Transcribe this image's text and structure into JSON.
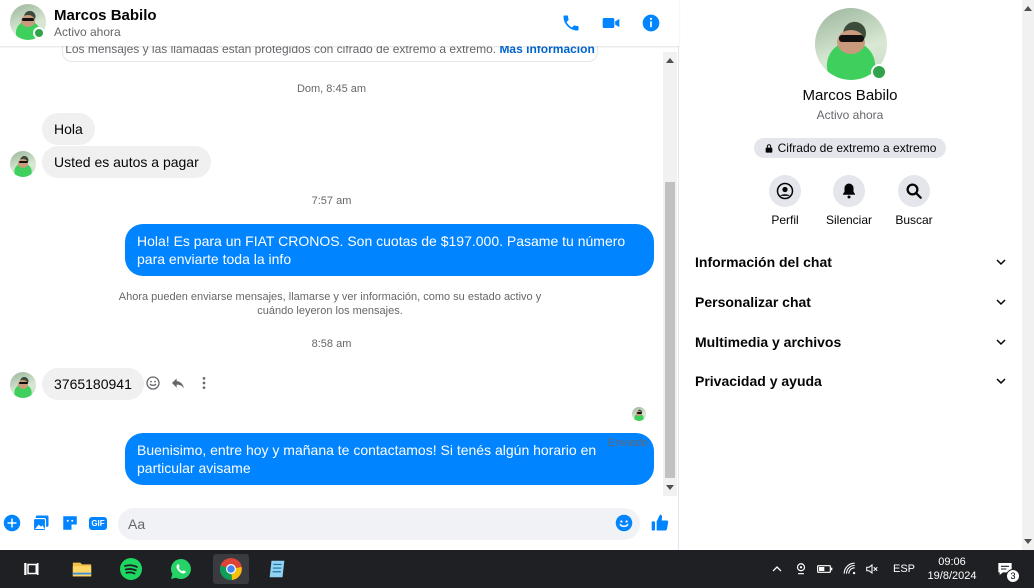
{
  "contact": {
    "name": "Marcos Babilo",
    "status": "Activo ahora"
  },
  "banner": {
    "text": "Los mensajes y las llamadas están protegidos con cifrado de extremo a extremo.",
    "link": "Más información"
  },
  "conversation": {
    "ts1": "Dom, 8:45 am",
    "msg1": "Hola",
    "msg2": "Usted es autos a pagar",
    "ts2": "7:57 am",
    "msg3": "Hola! Es para un FIAT CRONOS. Son cuotas de $197.000. Pasame tu número para enviarte toda la info",
    "notice": "Ahora pueden enviarse mensajes, llamarse y ver información, como su estado activo y cuándo leyeron los mensajes.",
    "ts3": "8:58 am",
    "msg4": "3765180941",
    "msg5": "Buenisimo, entre hoy y mañana te contactamos! Si tenés algún horario en particular avisame",
    "sent_label": "Enviado"
  },
  "composer": {
    "placeholder": "Aa"
  },
  "info_panel": {
    "e2e_label": "Cifrado de extremo a extremo",
    "actions": [
      {
        "label": "Perfil",
        "icon": "profile-icon"
      },
      {
        "label": "Silenciar",
        "icon": "bell-icon"
      },
      {
        "label": "Buscar",
        "icon": "search-icon"
      }
    ],
    "sections": [
      {
        "label": "Información del chat"
      },
      {
        "label": "Personalizar chat"
      },
      {
        "label": "Multimedia y archivos"
      },
      {
        "label": "Privacidad y ayuda"
      }
    ]
  },
  "taskbar": {
    "language": "ESP",
    "time": "09:06",
    "date": "19/8/2024",
    "notifications": "3"
  },
  "colors": {
    "accent": "#0084ff",
    "incoming_bubble": "#f0f0f0",
    "online": "#31a24c",
    "taskbar": "#1f2024"
  }
}
